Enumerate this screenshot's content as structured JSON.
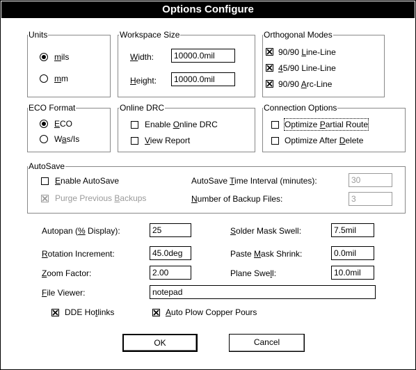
{
  "title": "Options Configure",
  "units": {
    "group_label": "Units",
    "mils": {
      "pre": "",
      "ul": "m",
      "post": "ils",
      "selected": true
    },
    "mm": {
      "pre": "",
      "ul": "m",
      "post": "m",
      "selected": false
    }
  },
  "workspace": {
    "group_label": "Workspace Size",
    "width": {
      "pre": "",
      "ul": "W",
      "post": "idth:",
      "value": "10000.0mil"
    },
    "height": {
      "pre": "",
      "ul": "H",
      "post": "eight:",
      "value": "10000.0mil"
    }
  },
  "ortho": {
    "group_label": "Orthogonal Modes",
    "m1": {
      "pre": "90/90 ",
      "ul": "L",
      "post": "ine-Line",
      "checked": true
    },
    "m2": {
      "pre": "",
      "ul": "4",
      "post": "5/90  Line-Line",
      "checked": true
    },
    "m3": {
      "pre": "90/90 ",
      "ul": "A",
      "post": "rc-Line",
      "checked": true
    }
  },
  "eco": {
    "group_label": "ECO Format",
    "eco": {
      "pre": "",
      "ul": "E",
      "post": "CO",
      "selected": true
    },
    "wasis": {
      "pre": "W",
      "ul": "a",
      "post": "s/Is",
      "selected": false
    }
  },
  "drc": {
    "group_label": "Online DRC",
    "enable": {
      "pre": "Enable ",
      "ul": "O",
      "post": "nline DRC",
      "checked": false
    },
    "view": {
      "pre": "",
      "ul": "V",
      "post": "iew Report",
      "checked": false
    }
  },
  "conn": {
    "group_label": "Connection Options",
    "partial": {
      "pre": "Optimize ",
      "ul": "P",
      "post": "artial Route",
      "checked": false
    },
    "delete": {
      "pre": "Optimize After ",
      "ul": "D",
      "post": "elete",
      "checked": false
    }
  },
  "autosave": {
    "group_label": "AutoSave",
    "enable": {
      "pre": "",
      "ul": "E",
      "post": "nable AutoSave",
      "checked": false
    },
    "purge": {
      "pre": "Purge Previous ",
      "ul": "B",
      "post": "ackups",
      "checked": true
    },
    "interval": {
      "pre": "AutoSave ",
      "ul": "T",
      "post": "ime Interval (minutes):",
      "value": "30"
    },
    "count": {
      "pre": "",
      "ul": "N",
      "post": "umber of Backup Files:",
      "value": "3"
    }
  },
  "params": {
    "autopan": {
      "pre": "Autopan (",
      "ul": "%",
      "post": " Display):",
      "value": "25"
    },
    "rotation": {
      "pre": "",
      "ul": "R",
      "post": "otation Increment:",
      "value": "45.0deg"
    },
    "zoom": {
      "pre": "",
      "ul": "Z",
      "post": "oom Factor:",
      "value": "2.00"
    },
    "solder": {
      "pre": "",
      "ul": "S",
      "post": "older Mask Swell:",
      "value": "7.5mil"
    },
    "paste": {
      "pre": "Paste ",
      "ul": "M",
      "post": "ask Shrink:",
      "value": "0.0mil"
    },
    "plane": {
      "pre": "Plane Swe",
      "ul": "l",
      "post": "l:",
      "value": "10.0mil"
    },
    "viewer": {
      "pre": "",
      "ul": "F",
      "post": "ile Viewer:",
      "value": "notepad"
    }
  },
  "bottom": {
    "dde": {
      "pre": "DDE Ho",
      "ul": "t",
      "post": "links",
      "checked": true
    },
    "plow": {
      "pre": "",
      "ul": "A",
      "post": "uto Plow Copper Pours",
      "checked": true
    }
  },
  "buttons": {
    "ok": "OK",
    "cancel": "Cancel"
  }
}
